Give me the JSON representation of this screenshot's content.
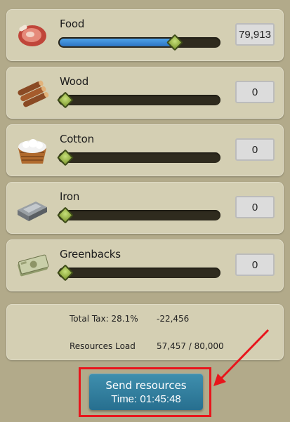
{
  "resources": [
    {
      "name": "Food",
      "icon": "meat-icon",
      "amount": "79,913",
      "fill_fraction": 0.73
    },
    {
      "name": "Wood",
      "icon": "wood-logs-icon",
      "amount": "0",
      "fill_fraction": 0
    },
    {
      "name": "Cotton",
      "icon": "cotton-basket-icon",
      "amount": "0",
      "fill_fraction": 0
    },
    {
      "name": "Iron",
      "icon": "iron-ingot-icon",
      "amount": "0",
      "fill_fraction": 0
    },
    {
      "name": "Greenbacks",
      "icon": "money-bills-icon",
      "amount": "0",
      "fill_fraction": 0
    }
  ],
  "summary": {
    "tax_label": "Total Tax: 28.1%",
    "tax_value": "-22,456",
    "load_label": "Resources Load",
    "load_value": "57,457 / 80,000"
  },
  "send": {
    "label": "Send resources",
    "time": "Time: 01:45:48"
  },
  "colors": {
    "background": "#b2aa8a",
    "panel": "#d4cfb3",
    "slider_fill": "#2c74c1",
    "button": "#2f7f9f",
    "highlight": "#e8151c"
  }
}
